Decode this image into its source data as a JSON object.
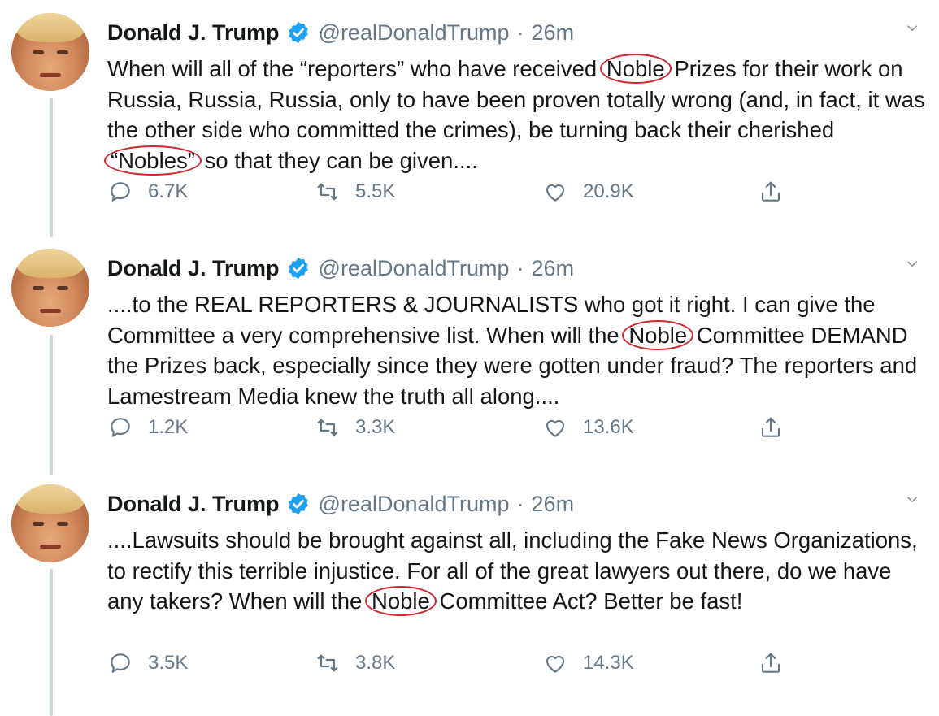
{
  "tweets": [
    {
      "author": {
        "name": "Donald J. Trump",
        "handle": "@realDonaldTrump",
        "time": "26m"
      },
      "text": [
        "When will all of the “reporters” who have received ",
        {
          "circled": "Noble"
        },
        " Prizes for their work on Russia, Russia, Russia, only to have been proven totally wrong (and, in fact, it was the other side who committed the crimes), be turning back their cherished ",
        {
          "circled": "“Nobles”"
        },
        " so that they can be given...."
      ],
      "counts": {
        "replies": "6.7K",
        "retweets": "5.5K",
        "likes": "20.9K"
      }
    },
    {
      "author": {
        "name": "Donald J. Trump",
        "handle": "@realDonaldTrump",
        "time": "26m"
      },
      "text": [
        "....to the REAL REPORTERS & JOURNALISTS who got it right. I can give the Committee a very comprehensive list. When will the ",
        {
          "circled": "Noble"
        },
        " Committee DEMAND the Prizes back, especially since they were gotten under fraud? The reporters and Lamestream Media knew the truth all along...."
      ],
      "counts": {
        "replies": "1.2K",
        "retweets": "3.3K",
        "likes": "13.6K"
      }
    },
    {
      "author": {
        "name": "Donald J. Trump",
        "handle": "@realDonaldTrump",
        "time": "26m"
      },
      "text": [
        "....Lawsuits should be brought against all, including the Fake News Organizations, to rectify this terrible injustice. For all of the great lawyers out there, do we have any takers? When will the ",
        {
          "circled": "Noble"
        },
        " Committee Act? Better be fast!"
      ],
      "counts": {
        "replies": "3.5K",
        "retweets": "3.8K",
        "likes": "14.3K"
      }
    }
  ],
  "colors": {
    "annotation": "#d0262d",
    "muted": "#657786",
    "verified": "#1da1f2",
    "thread": "#ccd6dd"
  },
  "icons": {
    "reply": "speech-bubble-icon",
    "retweet": "retweet-arrows-icon",
    "like": "heart-icon",
    "share": "share-upload-icon",
    "verified": "verified-badge-icon",
    "menu": "chevron-down-icon"
  }
}
